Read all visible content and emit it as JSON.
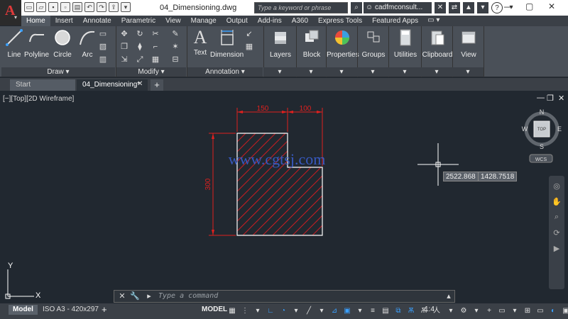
{
  "titlebar": {
    "document_title": "04_Dimensioning.dwg",
    "search_placeholder": "Type a keyword or phrase",
    "user": "cadfmconsult...",
    "help": "?"
  },
  "ribbon_tabs": [
    "Home",
    "Insert",
    "Annotate",
    "Parametric",
    "View",
    "Manage",
    "Output",
    "Add-ins",
    "A360",
    "Express Tools",
    "Featured Apps"
  ],
  "ribbon": {
    "draw_tools": [
      "Line",
      "Polyline",
      "Circle",
      "Arc"
    ],
    "draw_panel": "Draw",
    "modify_panel": "Modify",
    "annotation_tools": [
      "Text",
      "Dimension"
    ],
    "annotation_panel": "Annotation",
    "big_tools": [
      "Layers",
      "Block",
      "Properties",
      "Groups",
      "Utilities",
      "Clipboard",
      "View"
    ]
  },
  "file_tabs": {
    "start": "Start",
    "document": "04_Dimensioning*"
  },
  "viewport": {
    "label": "[−][Top][2D Wireframe]",
    "viewcube": {
      "north": "N",
      "south": "S",
      "east": "E",
      "west": "W",
      "top": "TOP"
    },
    "wcs": "WCS",
    "watermark": "www.cgtsj.com",
    "ucs_x": "X",
    "ucs_y": "Y",
    "coord_x": "2522.868",
    "coord_y": "1428.7518"
  },
  "dimensions": {
    "top_left": "150",
    "top_right": "100",
    "height": "300"
  },
  "command_line": {
    "placeholder": "Type a command"
  },
  "status": {
    "layout_model": "Model",
    "layout_iso": "ISO A3 - 420x297",
    "model": "MODEL",
    "scale": "1:4"
  },
  "colors": {
    "dimension": "#e0201e",
    "hatch": "#c81e24",
    "watermark": "#3a5fd0",
    "object": "#ffffff",
    "background": "#212830"
  }
}
